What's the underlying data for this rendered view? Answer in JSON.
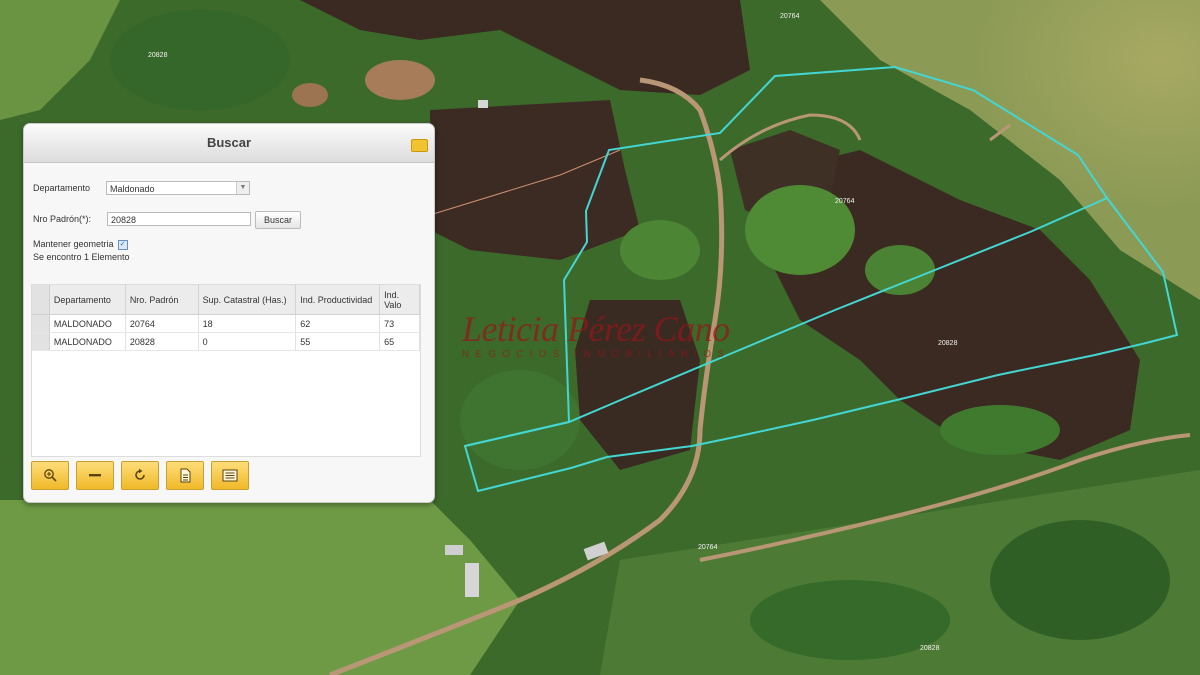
{
  "dialog": {
    "title": "Buscar",
    "departamento_label": "Departamento",
    "departamento_value": "Maldonado",
    "padron_label": "Nro Padrón(*):",
    "padron_value": "20828",
    "buscar_button": "Buscar",
    "mantener_label": "Mantener geometria",
    "mantener_checked": true,
    "status": "Se encontro 1 Elemento"
  },
  "results": {
    "headers": [
      "Departamento",
      "Nro. Padrón",
      "Sup. Catastral (Has.)",
      "Ind. Productividad",
      "Ind. Valo"
    ],
    "rows": [
      [
        "MALDONADO",
        "20764",
        "18",
        "62",
        "73"
      ],
      [
        "MALDONADO",
        "20828",
        "0",
        "55",
        "65"
      ]
    ]
  },
  "toolbar": [
    "zoom-in-icon",
    "remove-icon",
    "refresh-icon",
    "document-icon",
    "list-icon"
  ],
  "watermark": {
    "name": "Leticia Pérez Cano",
    "subtitle": "NEGOCIOS INMOBILIARIOS"
  },
  "map": {
    "parcel_color": "#44d6d2",
    "parcel_labels": [
      "20764",
      "20828",
      "20764",
      "20828",
      "20764",
      "20828"
    ]
  }
}
